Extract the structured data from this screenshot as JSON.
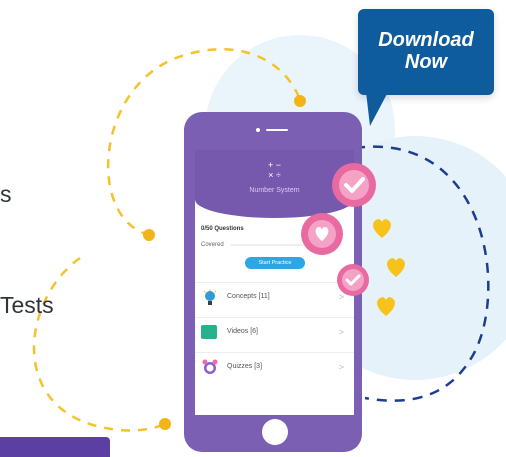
{
  "left": {
    "partial_line_1": "s",
    "partial_line_2": "Tests"
  },
  "phone": {
    "math_symbols_top": "+ −",
    "math_symbols_bottom": "× ÷",
    "topic": "Number System",
    "questions": "0/50 Questions",
    "covered_label": "Covered",
    "start_button": "Start Practice",
    "list": [
      {
        "label": "Concepts [11]",
        "icon": "bulb-icon"
      },
      {
        "label": "Videos [6]",
        "icon": "video-icon"
      },
      {
        "label": "Quizzes [3]",
        "icon": "alarm-icon"
      }
    ]
  },
  "download": {
    "line1": "Download",
    "line2": "Now"
  },
  "colors": {
    "purple": "#7659ad",
    "blue": "#0e5b9d",
    "pink": "#e86aa0",
    "yellow": "#f7c21a",
    "dash_yellow": "#f3c22c",
    "dash_navy": "#1d3d8f"
  }
}
